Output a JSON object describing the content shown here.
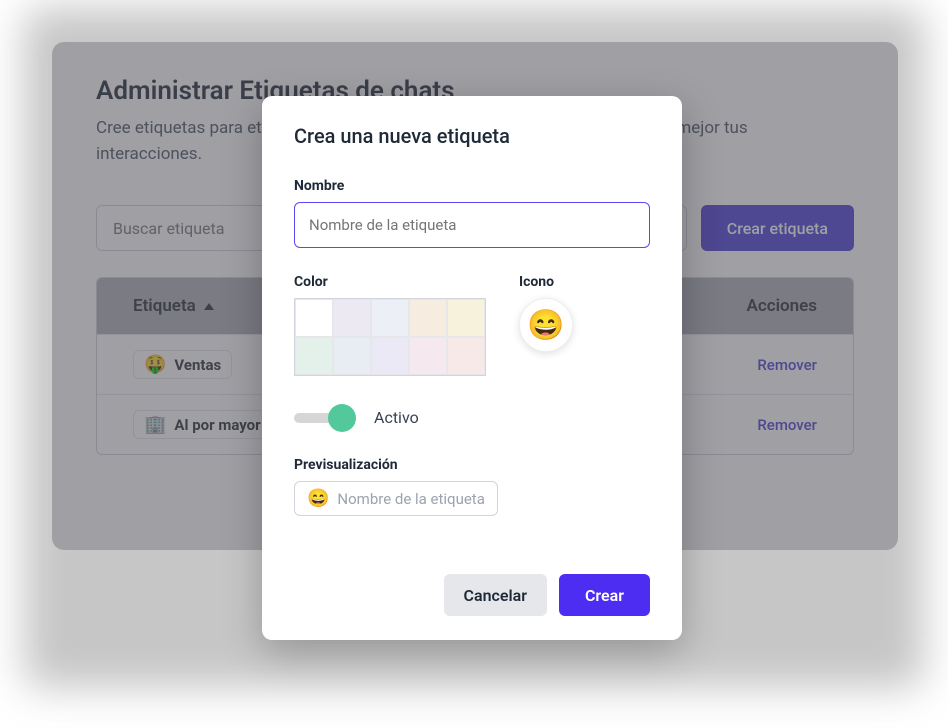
{
  "page": {
    "title": "Administrar Etiquetas de chats",
    "description": "Cree etiquetas para etiquetar, categorizar y organizar tus chats y así conocer mejor tus interacciones."
  },
  "toolbar": {
    "search_placeholder": "Buscar etiqueta",
    "create_label": "Crear etiqueta"
  },
  "table": {
    "headers": {
      "tag": "Etiqueta",
      "actions": "Acciones"
    },
    "rows": [
      {
        "emoji": "🤑",
        "label": "Ventas",
        "remove": "Remover"
      },
      {
        "emoji": "🏢",
        "label": "Al por mayor",
        "remove": "Remover"
      }
    ]
  },
  "modal": {
    "title": "Crea una nueva etiqueta",
    "name_label": "Nombre",
    "name_placeholder": "Nombre de la etiqueta",
    "color_label": "Color",
    "colors": [
      "#ffffff",
      "#ece9f2",
      "#eceff5",
      "#f6ecdf",
      "#f7f2db",
      "#e4f0ea",
      "#e7edf3",
      "#ebe9f5",
      "#f5e8ef",
      "#f6e9e8"
    ],
    "icon_label": "Icono",
    "icon_emoji": "😄",
    "toggle_label": "Activo",
    "toggle_on": true,
    "preview_label": "Previsualización",
    "preview_emoji": "😄",
    "preview_text": "Nombre de la etiqueta",
    "cancel": "Cancelar",
    "create": "Crear"
  }
}
